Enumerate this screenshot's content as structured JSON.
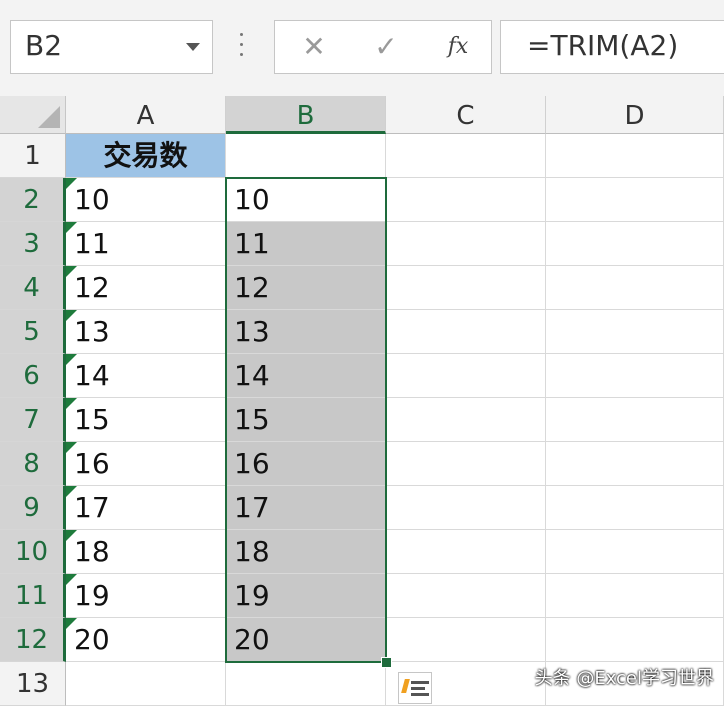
{
  "name_box": {
    "value": "B2"
  },
  "formula_bar": {
    "cancel_glyph": "✕",
    "enter_glyph": "✓",
    "fx_glyph": "fx",
    "formula": "=TRIM(A2)"
  },
  "columns": [
    "A",
    "B",
    "C",
    "D"
  ],
  "rows": [
    "1",
    "2",
    "3",
    "4",
    "5",
    "6",
    "7",
    "8",
    "9",
    "10",
    "11",
    "12",
    "13"
  ],
  "selected": {
    "column": "B",
    "rows_from": 2,
    "rows_to": 12
  },
  "column_a": [
    "交易数",
    "10",
    "11",
    "12",
    "13",
    "14",
    "15",
    "16",
    "17",
    "18",
    "19",
    "20",
    ""
  ],
  "column_b": [
    "",
    "10",
    "11",
    "12",
    "13",
    "14",
    "15",
    "16",
    "17",
    "18",
    "19",
    "20",
    ""
  ],
  "watermark": "头条 @Excel学习世界",
  "colors": {
    "header_fill": "#9dc3e6",
    "selection": "#1e6b3c",
    "shade": "#c8c8c8",
    "error_flag": "#1e7b3c"
  }
}
